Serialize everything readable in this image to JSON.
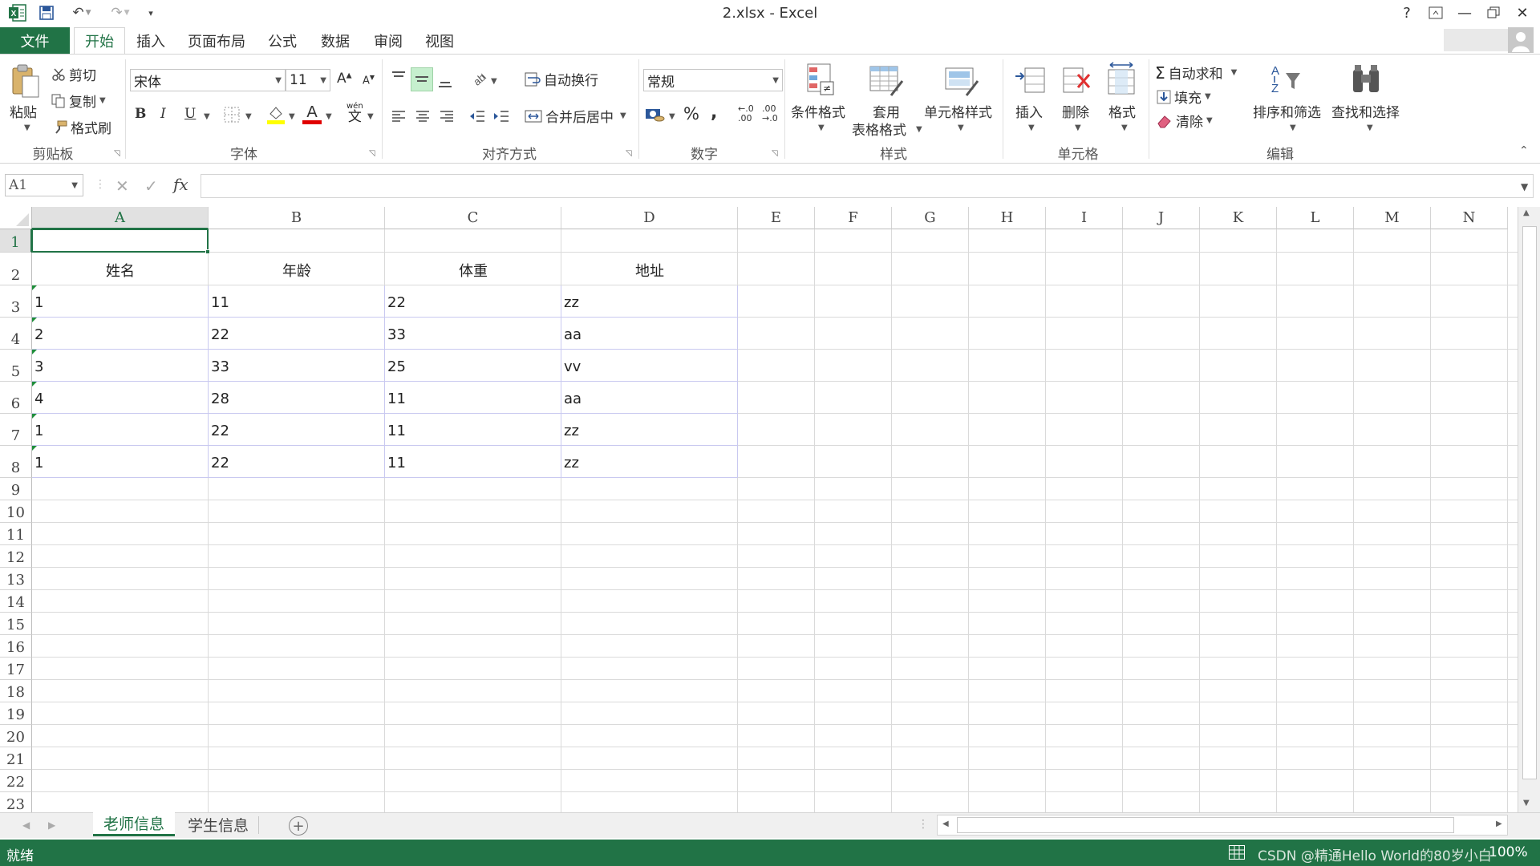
{
  "window": {
    "title": "2.xlsx - Excel",
    "help": "?"
  },
  "tabs": [
    {
      "label": "文件"
    },
    {
      "label": "开始"
    },
    {
      "label": "插入"
    },
    {
      "label": "页面布局"
    },
    {
      "label": "公式"
    },
    {
      "label": "数据"
    },
    {
      "label": "审阅"
    },
    {
      "label": "视图"
    }
  ],
  "ribbon": {
    "clipboard": {
      "paste": "粘贴",
      "cut": "剪切",
      "copy": "复制",
      "format_painter": "格式刷",
      "label": "剪贴板"
    },
    "font": {
      "name": "宋体",
      "size": "11",
      "bold": "B",
      "italic": "I",
      "underline": "U",
      "label": "字体",
      "wen": "wén",
      "wen2": "文",
      "grow": "A",
      "shrink": "A"
    },
    "alignment": {
      "wrap": "自动换行",
      "merge": "合并后居中",
      "label": "对齐方式"
    },
    "number": {
      "format": "常规",
      "percent": "%",
      "comma": ",",
      "label": "数字"
    },
    "styles": {
      "conditional": "条件格式",
      "table1": "套用",
      "table2": "表格格式",
      "cell_styles": "单元格样式",
      "label": "样式"
    },
    "cells": {
      "insert": "插入",
      "delete": "删除",
      "format": "格式",
      "label": "单元格"
    },
    "editing": {
      "autosum": "自动求和",
      "fill": "填充",
      "clear": "清除",
      "sort": "排序和筛选",
      "find": "查找和选择",
      "label": "编辑"
    }
  },
  "formula_bar": {
    "name_box": "A1",
    "fx": "fx",
    "value": ""
  },
  "columns": [
    "A",
    "B",
    "C",
    "D",
    "E",
    "F",
    "G",
    "H",
    "I",
    "J",
    "K",
    "L",
    "M",
    "N"
  ],
  "rows": [
    "1",
    "2",
    "3",
    "4",
    "5",
    "6",
    "7",
    "8",
    "9",
    "10",
    "11",
    "12",
    "13",
    "14",
    "15",
    "16",
    "17",
    "18",
    "19",
    "20",
    "21",
    "22",
    "23"
  ],
  "table": {
    "headers": [
      "姓名",
      "年龄",
      "体重",
      "地址"
    ],
    "data": [
      [
        "1",
        "11",
        "22",
        "zz"
      ],
      [
        "2",
        "22",
        "33",
        "aa"
      ],
      [
        "3",
        "33",
        "25",
        "vv"
      ],
      [
        "4",
        "28",
        "11",
        "aa"
      ],
      [
        "1",
        "22",
        "11",
        "zz"
      ],
      [
        "1",
        "22",
        "11",
        "zz"
      ]
    ]
  },
  "sheets": [
    {
      "label": "老师信息",
      "active": true
    },
    {
      "label": "学生信息",
      "active": false
    }
  ],
  "status": {
    "ready": "就绪",
    "zoom": "100%",
    "watermark": "CSDN @精通Hello World的80岁小白"
  },
  "colors": {
    "accent": "#217346",
    "selected_border": "#217346",
    "comment_marker": "#1e8d3a"
  }
}
